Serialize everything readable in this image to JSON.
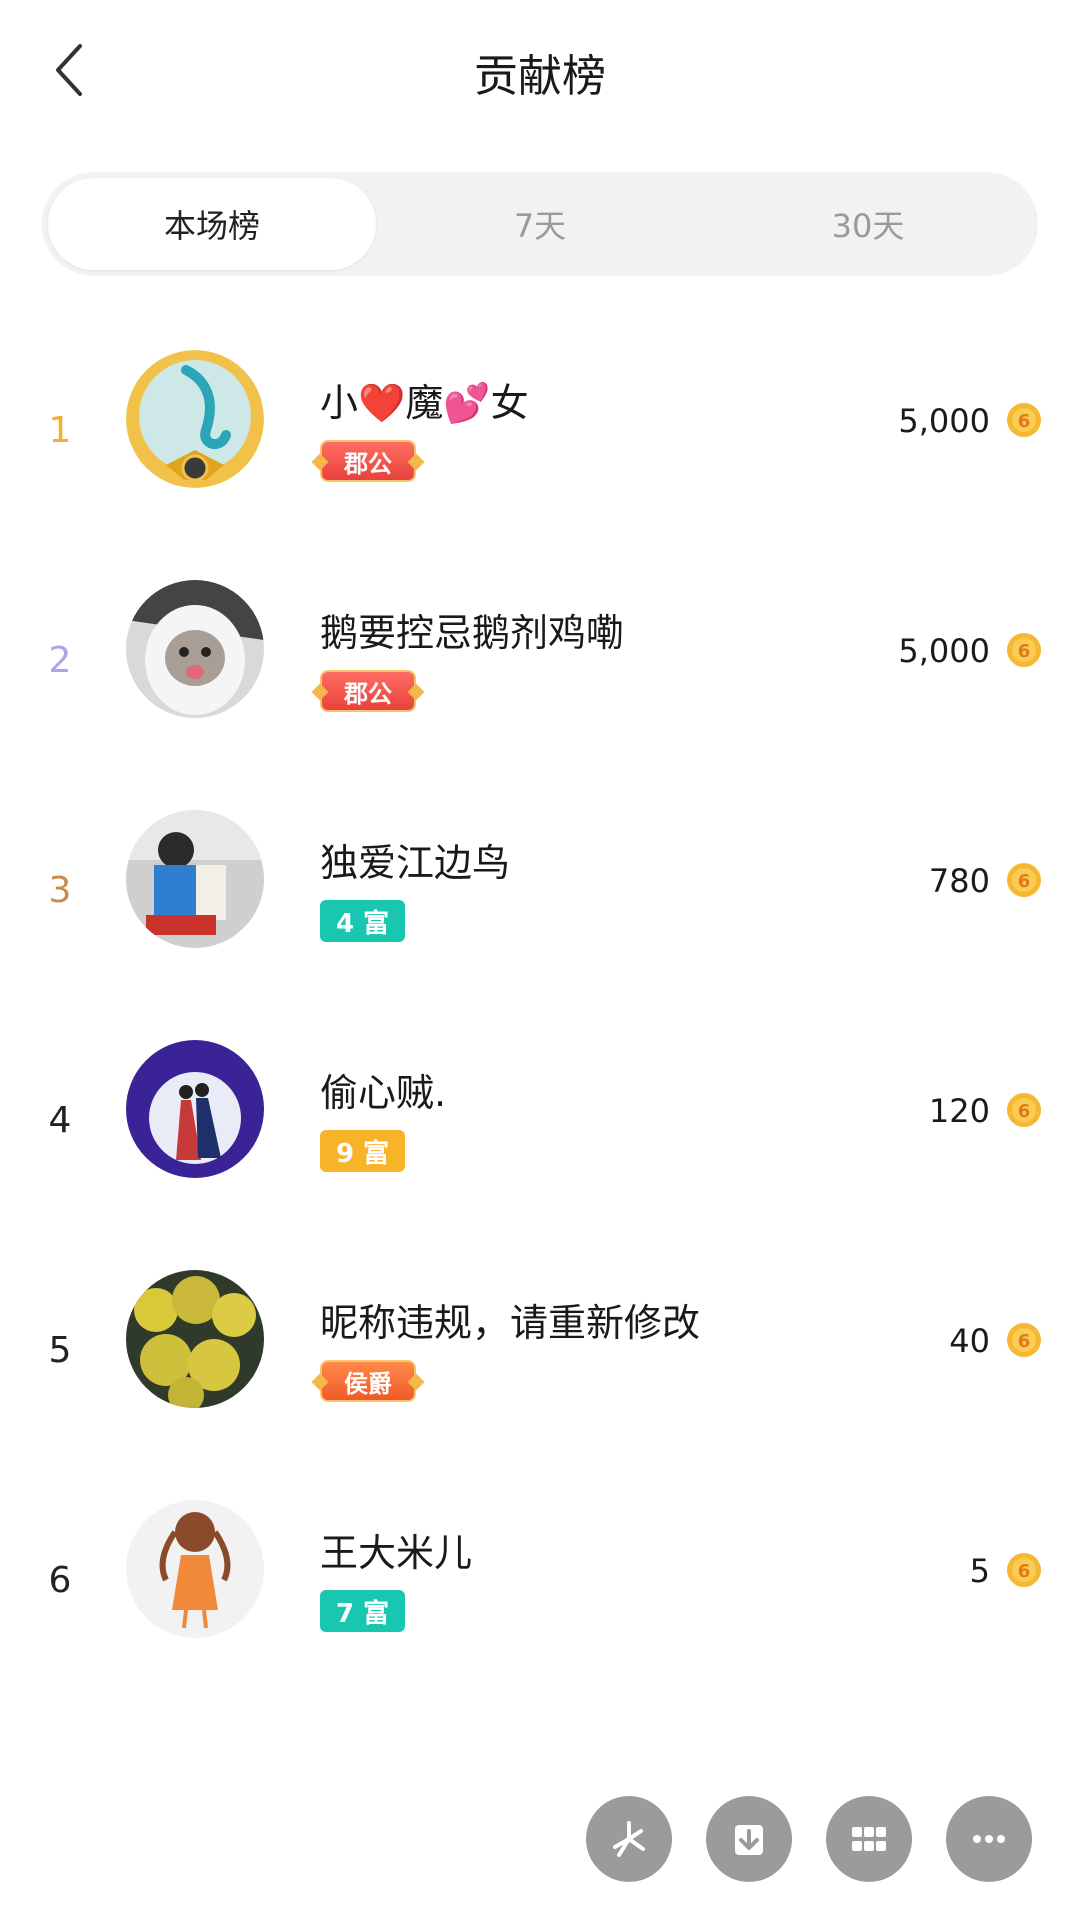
{
  "header": {
    "title": "贡献榜"
  },
  "tabs": [
    {
      "label": "本场榜",
      "active": true
    },
    {
      "label": "7天",
      "active": false
    },
    {
      "label": "30天",
      "active": false
    }
  ],
  "rows": [
    {
      "rank": "1",
      "rank_color": "#f2b12c",
      "name": "小❤️魔💕女",
      "badge": "郡公",
      "badge_type": "title",
      "value": "5,000"
    },
    {
      "rank": "2",
      "rank_color": "#a8a6e8",
      "name": "鹅要控忌鹅剂鸡嘞",
      "badge": "郡公",
      "badge_type": "title",
      "value": "5,000"
    },
    {
      "rank": "3",
      "rank_color": "#cc8a4d",
      "name": "独爱江边鸟",
      "badge": "4 富",
      "badge_type": "rich",
      "badge_color": "#19c7b0",
      "value": "780"
    },
    {
      "rank": "4",
      "rank_color": "#222222",
      "name": "偷心贼.",
      "badge": "9 富",
      "badge_type": "rich",
      "badge_color": "#f8b429",
      "value": "120"
    },
    {
      "rank": "5",
      "rank_color": "#222222",
      "name": "昵称违规，请重新修改",
      "badge": "侯爵",
      "badge_type": "title",
      "value": "40"
    },
    {
      "rank": "6",
      "rank_color": "#222222",
      "name": "王大米儿",
      "badge": "7 富",
      "badge_type": "rich",
      "badge_color": "#19c7b0",
      "value": "5"
    }
  ],
  "fab_buttons": [
    "pinwheel-icon",
    "download-icon",
    "grid-icon",
    "more-icon"
  ]
}
